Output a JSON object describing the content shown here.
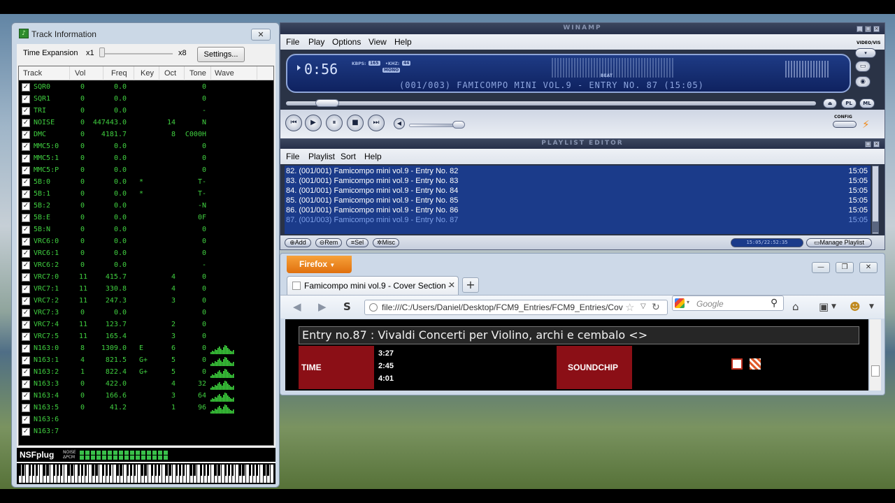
{
  "track_info": {
    "title": "Track Information",
    "time_expansion_label": "Time Expansion",
    "x1": "x1",
    "x8": "x8",
    "settings_label": "Settings...",
    "columns": [
      "Track",
      "Vol",
      "Freq",
      "Key",
      "Oct",
      "Tone",
      "Wave"
    ],
    "rows": [
      {
        "name": "SQR0",
        "vol": "0",
        "freq": "0.0",
        "key": "",
        "oct": "",
        "tone": "0",
        "wave": false
      },
      {
        "name": "SQR1",
        "vol": "0",
        "freq": "0.0",
        "key": "",
        "oct": "",
        "tone": "0",
        "wave": false
      },
      {
        "name": "TRI",
        "vol": "0",
        "freq": "0.0",
        "key": "",
        "oct": "",
        "tone": "-",
        "wave": false
      },
      {
        "name": "NOISE",
        "vol": "0",
        "freq": "447443.0",
        "key": "",
        "oct": "14",
        "tone": "N",
        "wave": false
      },
      {
        "name": "DMC",
        "vol": "0",
        "freq": "4181.7",
        "key": "",
        "oct": "8",
        "tone": "C000H",
        "wave": false
      },
      {
        "name": "MMC5:0",
        "vol": "0",
        "freq": "0.0",
        "key": "",
        "oct": "",
        "tone": "0",
        "wave": false
      },
      {
        "name": "MMC5:1",
        "vol": "0",
        "freq": "0.0",
        "key": "",
        "oct": "",
        "tone": "0",
        "wave": false
      },
      {
        "name": "MMC5:P",
        "vol": "0",
        "freq": "0.0",
        "key": "",
        "oct": "",
        "tone": "0",
        "wave": false
      },
      {
        "name": "5B:0",
        "vol": "0",
        "freq": "0.0",
        "key": "*",
        "oct": "",
        "tone": "T-",
        "wave": false
      },
      {
        "name": "5B:1",
        "vol": "0",
        "freq": "0.0",
        "key": "*",
        "oct": "",
        "tone": "T-",
        "wave": false
      },
      {
        "name": "5B:2",
        "vol": "0",
        "freq": "0.0",
        "key": "",
        "oct": "",
        "tone": "-N",
        "wave": false
      },
      {
        "name": "5B:E",
        "vol": "0",
        "freq": "0.0",
        "key": "",
        "oct": "",
        "tone": "0F",
        "wave": false
      },
      {
        "name": "5B:N",
        "vol": "0",
        "freq": "0.0",
        "key": "",
        "oct": "",
        "tone": "0",
        "wave": false
      },
      {
        "name": "VRC6:0",
        "vol": "0",
        "freq": "0.0",
        "key": "",
        "oct": "",
        "tone": "0",
        "wave": false
      },
      {
        "name": "VRC6:1",
        "vol": "0",
        "freq": "0.0",
        "key": "",
        "oct": "",
        "tone": "0",
        "wave": false
      },
      {
        "name": "VRC6:2",
        "vol": "0",
        "freq": "0.0",
        "key": "",
        "oct": "",
        "tone": "-",
        "wave": false
      },
      {
        "name": "VRC7:0",
        "vol": "11",
        "freq": "415.7",
        "key": "",
        "oct": "4",
        "tone": "0",
        "wave": false
      },
      {
        "name": "VRC7:1",
        "vol": "11",
        "freq": "330.8",
        "key": "",
        "oct": "4",
        "tone": "0",
        "wave": false
      },
      {
        "name": "VRC7:2",
        "vol": "11",
        "freq": "247.3",
        "key": "",
        "oct": "3",
        "tone": "0",
        "wave": false
      },
      {
        "name": "VRC7:3",
        "vol": "0",
        "freq": "0.0",
        "key": "",
        "oct": "",
        "tone": "0",
        "wave": false
      },
      {
        "name": "VRC7:4",
        "vol": "11",
        "freq": "123.7",
        "key": "",
        "oct": "2",
        "tone": "0",
        "wave": false
      },
      {
        "name": "VRC7:5",
        "vol": "11",
        "freq": "165.4",
        "key": "",
        "oct": "3",
        "tone": "0",
        "wave": false
      },
      {
        "name": "N163:0",
        "vol": "8",
        "freq": "1309.0",
        "key": "E",
        "oct": "6",
        "tone": "0",
        "wave": true
      },
      {
        "name": "N163:1",
        "vol": "4",
        "freq": "821.5",
        "key": "G+",
        "oct": "5",
        "tone": "0",
        "wave": true
      },
      {
        "name": "N163:2",
        "vol": "1",
        "freq": "822.4",
        "key": "G+",
        "oct": "5",
        "tone": "0",
        "wave": true
      },
      {
        "name": "N163:3",
        "vol": "0",
        "freq": "422.0",
        "key": "",
        "oct": "4",
        "tone": "32",
        "wave": true
      },
      {
        "name": "N163:4",
        "vol": "0",
        "freq": "166.6",
        "key": "",
        "oct": "3",
        "tone": "64",
        "wave": true
      },
      {
        "name": "N163:5",
        "vol": "0",
        "freq": "41.2",
        "key": "",
        "oct": "1",
        "tone": "96",
        "wave": true
      },
      {
        "name": "N163:6",
        "vol": "",
        "freq": "",
        "key": "",
        "oct": "",
        "tone": "",
        "wave": false
      },
      {
        "name": "N163:7",
        "vol": "",
        "freq": "",
        "key": "",
        "oct": "",
        "tone": "",
        "wave": false
      }
    ],
    "nsfplug_label": "NSFplug",
    "nsf_noise": "NOISE",
    "nsf_dpcm": "ΔPCM"
  },
  "winamp": {
    "title": "WINAMP",
    "menu": [
      "File",
      "Play",
      "Options",
      "View",
      "Help"
    ],
    "time": "0:56",
    "kbps_label": "KBPS:",
    "kbps_val": "165",
    "khz_label": "•KHZ:",
    "khz_val": "44",
    "mono_label": "MONO",
    "beat_label": "BEAT",
    "song_title": "(001/003) FAMICOMPO MINI VOL.9 - ENTRY NO. 87 (15:05)",
    "video_vis": "VIDEO/VIS",
    "pl_btn": "PL",
    "ml_btn": "ML",
    "config_label": "CONFIG",
    "seek_fraction": 0.06,
    "volume_fraction": 0.85
  },
  "playlist": {
    "title": "PLAYLIST EDITOR",
    "menu": [
      "File",
      "Playlist",
      "Sort",
      "Help"
    ],
    "items": [
      {
        "text": "82. (001/001) Famicompo mini vol.9 - Entry No. 82",
        "dur": "15:05"
      },
      {
        "text": "83. (001/001) Famicompo mini vol.9 - Entry No. 83",
        "dur": "15:05"
      },
      {
        "text": "84. (001/001) Famicompo mini vol.9 - Entry No. 84",
        "dur": "15:05"
      },
      {
        "text": "85. (001/001) Famicompo mini vol.9 - Entry No. 85",
        "dur": "15:05"
      },
      {
        "text": "86. (001/001) Famicompo mini vol.9 - Entry No. 86",
        "dur": "15:05"
      },
      {
        "text": "87. (001/003) Famicompo mini vol.9 - Entry No. 87",
        "dur": "15:05"
      }
    ],
    "add_btn": "Add",
    "rem_btn": "Rem",
    "sel_btn": "Sel",
    "misc_btn": "Misc",
    "status": "15:05/22:52:35",
    "manage_btn": "Manage Playlist"
  },
  "firefox": {
    "menu_btn": "Firefox",
    "tab_title": "Famicompo mini vol.9 - Cover Section -",
    "url": "file:///C:/Users/Daniel/Desktop/FCM9_Entries/FCM9_Entries/Cov",
    "search_placeholder": "Google",
    "entry_heading": "Entry no.87 : Vivaldi Concerti per Violino, archi e cembalo <>",
    "time_label": "TIME",
    "times": [
      "3:27",
      "2:45",
      "4:01"
    ],
    "soundchip_label": "SOUNDCHIP"
  }
}
